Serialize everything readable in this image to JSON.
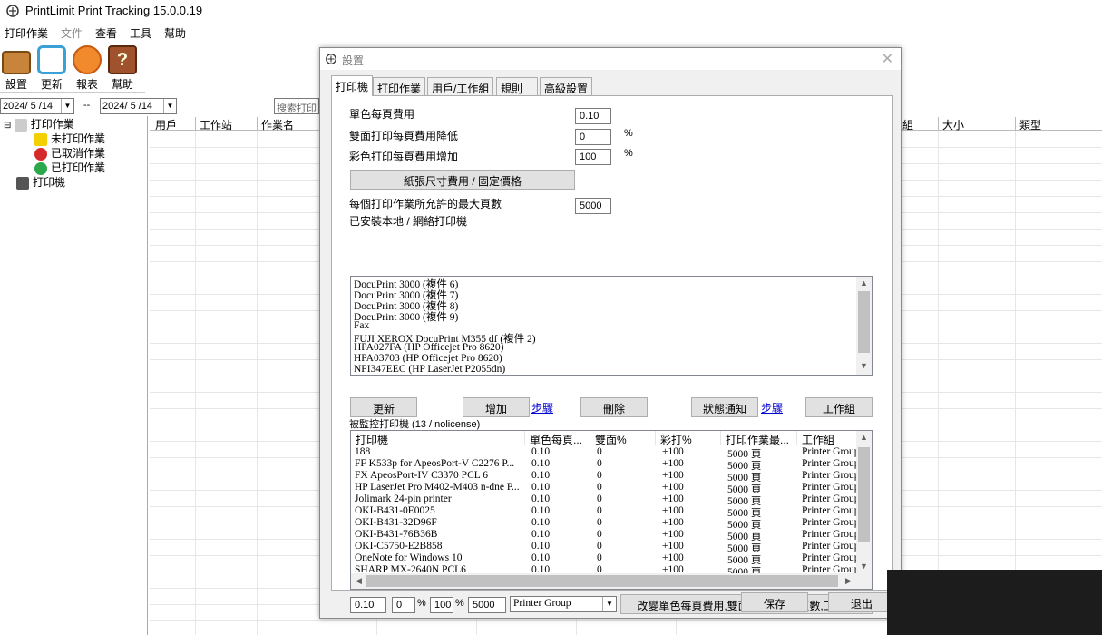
{
  "window": {
    "title": "PrintLimit Print Tracking 15.0.0.19"
  },
  "menu": [
    "打印作業",
    "文件",
    "查看",
    "工具",
    "幫助"
  ],
  "toolbar": {
    "settings": "設置",
    "refresh": "更新",
    "report": "報表",
    "help": "幫助"
  },
  "datebar": {
    "from": "2024/ 5 /14",
    "sep": "--",
    "to": "2024/ 5 /14",
    "search_placeholder": "搜索打印"
  },
  "tree": {
    "root": "打印作業",
    "pending": "未打印作業",
    "cancelled": "已取消作業",
    "printed": "已打印作業",
    "printers": "打印機"
  },
  "grid": {
    "col_user": "用戶",
    "col_station": "工作站",
    "col_job": "作業名",
    "col_group": "組",
    "col_size": "大小",
    "col_type": "類型"
  },
  "dialog": {
    "title": "設置",
    "tabs": [
      "打印機",
      "打印作業",
      "用戶/工作組",
      "規則",
      "高級設置"
    ],
    "mono_label": "單色每頁費用",
    "mono_value": "0.10",
    "duplex_label": "雙面打印每頁費用降低",
    "duplex_value": "0",
    "pct": "%",
    "color_label": "彩色打印每頁費用增加",
    "color_value": "100",
    "paper_btn": "紙張尺寸費用 / 固定價格",
    "maxpages_label": "每個打印作業所允許的最大頁數",
    "maxpages_value": "5000",
    "installed_label": "已安裝本地 / 網絡打印機",
    "installed": [
      "DocuPrint 3000 (複件 6)",
      "DocuPrint 3000 (複件 7)",
      "DocuPrint 3000 (複件 8)",
      "DocuPrint 3000 (複件 9)",
      "Fax",
      "FUJI XEROX DocuPrint M355 df (複件 2)",
      "HPA027FA (HP Officejet Pro 8620)",
      "HPA03703 (HP Officejet Pro 8620)",
      "NPI347EEC (HP LaserJet P2055dn)"
    ],
    "btn_refresh": "更新",
    "btn_add": "增加",
    "link_steps1": "步驟",
    "btn_delete": "刪除",
    "btn_status": "狀態通知",
    "link_steps2": "步驟",
    "btn_workgroup": "工作組",
    "monitored_label": "被監控打印機 (13 / nolicense)",
    "table_headers": [
      "打印機",
      "單色每頁...",
      "雙面%",
      "彩打%",
      "打印作業最...",
      "工作組"
    ],
    "rows": [
      [
        "188",
        "0.10",
        "0",
        "+100",
        "5000 頁",
        "Printer Group"
      ],
      [
        "FF K533p for ApeosPort-V C2276 P...",
        "0.10",
        "0",
        "+100",
        "5000 頁",
        "Printer Group"
      ],
      [
        "FX ApeosPort-IV C3370 PCL 6",
        "0.10",
        "0",
        "+100",
        "5000 頁",
        "Printer Group"
      ],
      [
        "HP LaserJet Pro M402-M403 n-dne P...",
        "0.10",
        "0",
        "+100",
        "5000 頁",
        "Printer Group"
      ],
      [
        "Jolimark 24-pin printer",
        "0.10",
        "0",
        "+100",
        "5000 頁",
        "Printer Group"
      ],
      [
        "OKI-B431-0E0025",
        "0.10",
        "0",
        "+100",
        "5000 頁",
        "Printer Group"
      ],
      [
        "OKI-B431-32D96F",
        "0.10",
        "0",
        "+100",
        "5000 頁",
        "Printer Group"
      ],
      [
        "OKI-B431-76B36B",
        "0.10",
        "0",
        "+100",
        "5000 頁",
        "Printer Group"
      ],
      [
        "OKI-C5750-E2B858",
        "0.10",
        "0",
        "+100",
        "5000 頁",
        "Printer Group"
      ],
      [
        "OneNote for Windows 10",
        "0.10",
        "0",
        "+100",
        "5000 頁",
        "Printer Group"
      ],
      [
        "SHARP MX-2640N PCL6",
        "0.10",
        "0",
        "+100",
        "5000 頁",
        "Printer Group"
      ]
    ],
    "bottom": {
      "mono": "0.10",
      "duplex": "0",
      "pct": "%",
      "color": "100",
      "maxpages": "5000",
      "group": "Printer Group",
      "change_btn": "改變單色每頁費用,雙面,彩打,最大頁數,工作組"
    },
    "save": "保存",
    "exit": "退出"
  }
}
